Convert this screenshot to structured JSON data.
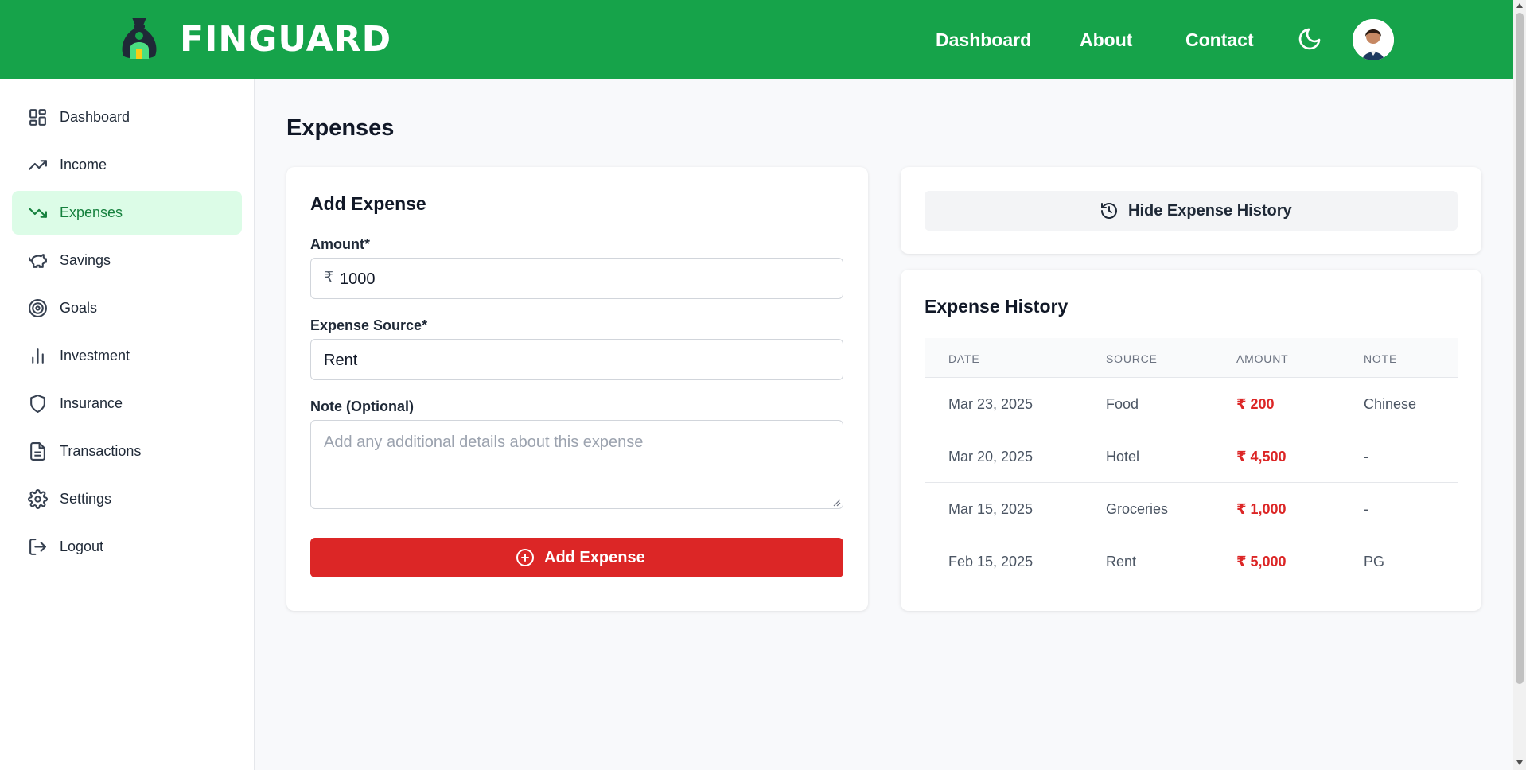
{
  "header": {
    "brand": "FINGUARD",
    "nav": [
      "Dashboard",
      "About",
      "Contact"
    ],
    "bg_color": "#16a34a",
    "icons": {
      "logo": "money-bag-icon",
      "theme": "moon-icon",
      "avatar": "user-avatar"
    }
  },
  "sidebar": {
    "items": [
      {
        "label": "Dashboard",
        "icon": "dashboard-grid-icon"
      },
      {
        "label": "Income",
        "icon": "trending-up-icon"
      },
      {
        "label": "Expenses",
        "icon": "trending-down-icon",
        "active": true
      },
      {
        "label": "Savings",
        "icon": "piggy-bank-icon"
      },
      {
        "label": "Goals",
        "icon": "target-icon"
      },
      {
        "label": "Investment",
        "icon": "bar-chart-icon"
      },
      {
        "label": "Insurance",
        "icon": "shield-icon"
      },
      {
        "label": "Transactions",
        "icon": "file-text-icon"
      },
      {
        "label": "Settings",
        "icon": "gear-icon"
      },
      {
        "label": "Logout",
        "icon": "logout-icon"
      }
    ]
  },
  "main": {
    "title": "Expenses",
    "form": {
      "title": "Add Expense",
      "amount_label": "Amount*",
      "currency_symbol": "₹",
      "amount_value": "1000",
      "source_label": "Expense Source*",
      "source_value": "Rent",
      "note_label": "Note (Optional)",
      "note_placeholder": "Add any additional details about this expense",
      "submit_label": "Add Expense"
    },
    "toggle_history_label": "Hide Expense History",
    "history": {
      "title": "Expense History",
      "columns": [
        "DATE",
        "SOURCE",
        "AMOUNT",
        "NOTE"
      ],
      "rows": [
        {
          "date": "Mar 23, 2025",
          "source": "Food",
          "amount": "₹ 200",
          "note": "Chinese"
        },
        {
          "date": "Mar 20, 2025",
          "source": "Hotel",
          "amount": "₹ 4,500",
          "note": "-"
        },
        {
          "date": "Mar 15, 2025",
          "source": "Groceries",
          "amount": "₹ 1,000",
          "note": "-"
        },
        {
          "date": "Feb 15, 2025",
          "source": "Rent",
          "amount": "₹ 5,000",
          "note": "PG"
        }
      ]
    }
  },
  "colors": {
    "accent": "#16a34a",
    "danger": "#dc2626",
    "active_bg": "#dcfce7"
  }
}
